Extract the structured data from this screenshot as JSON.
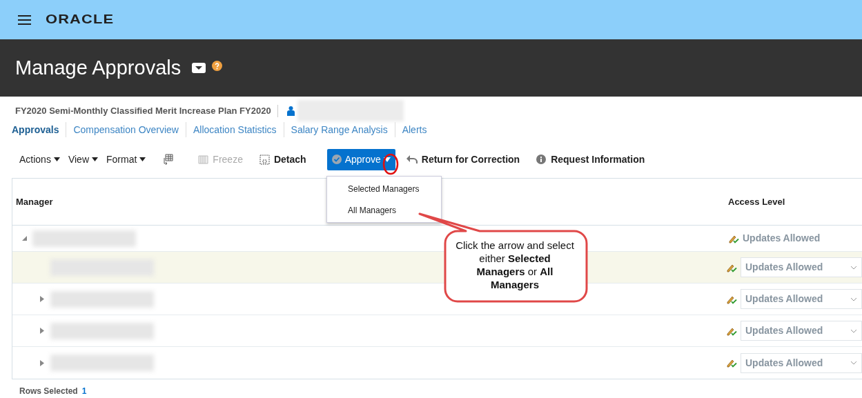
{
  "top_bar": {
    "logo": "ORACLE"
  },
  "header": {
    "title": "Manage Approvals"
  },
  "plan": {
    "name": "FY2020 Semi-Monthly Classified Merit Increase Plan FY2020"
  },
  "tabs": [
    {
      "label": "Approvals",
      "selected": true
    },
    {
      "label": "Compensation Overview",
      "selected": false
    },
    {
      "label": "Allocation Statistics",
      "selected": false
    },
    {
      "label": "Salary Range Analysis",
      "selected": false
    },
    {
      "label": "Alerts",
      "selected": false
    }
  ],
  "toolbar": [
    {
      "kind": "menu",
      "label": "Actions",
      "disabled": false
    },
    {
      "kind": "menu",
      "label": "View",
      "disabled": false
    },
    {
      "kind": "menu",
      "label": "Format",
      "disabled": false
    },
    {
      "kind": "icon",
      "disabled": false
    },
    {
      "kind": "freeze",
      "label": "Freeze",
      "disabled": true
    },
    {
      "kind": "detach",
      "label": "Detach",
      "disabled": false
    },
    {
      "kind": "split",
      "label": "Approve",
      "disabled": false
    },
    {
      "kind": "return",
      "label": "Return for Correction",
      "disabled": false
    },
    {
      "kind": "info",
      "label": "Request Information",
      "disabled": false
    }
  ],
  "approve_menu": [
    {
      "label": "Selected Managers"
    },
    {
      "label": "All Managers"
    }
  ],
  "table": {
    "columns": [
      "Manager",
      "Access Level"
    ],
    "rows": [
      {
        "expandable": true,
        "expanded": true,
        "selected": false,
        "access": {
          "kind": "text",
          "value": "Updates Allowed"
        },
        "children": [
          {
            "expandable": false,
            "expanded": false,
            "selected": true,
            "access": {
              "kind": "select",
              "value": "Updates Allowed"
            }
          },
          {
            "expandable": true,
            "expanded": false,
            "selected": false,
            "access": {
              "kind": "select",
              "value": "Updates Allowed"
            }
          },
          {
            "expandable": true,
            "expanded": false,
            "selected": false,
            "access": {
              "kind": "select",
              "value": "Updates Allowed"
            }
          },
          {
            "expandable": true,
            "expanded": false,
            "selected": false,
            "access": {
              "kind": "select",
              "value": "Updates Allowed"
            }
          }
        ]
      }
    ]
  },
  "footer": {
    "label": "Rows Selected",
    "count": "1"
  },
  "callout": {
    "text": "Click the arrow and select either **Selected Managers** or **All Managers**"
  }
}
